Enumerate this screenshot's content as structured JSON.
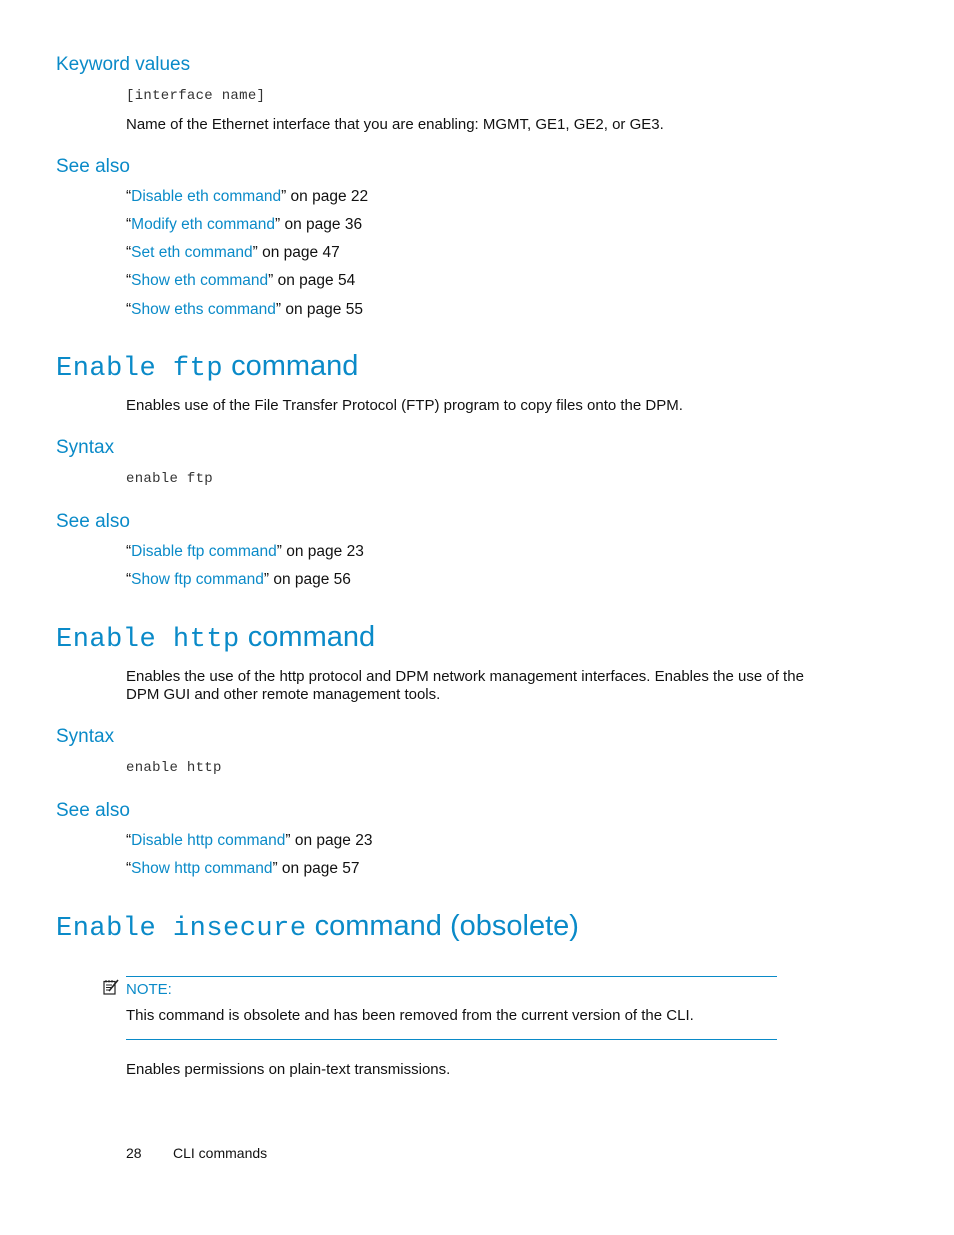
{
  "keyword_values": {
    "heading": "Keyword values",
    "param": "[interface name]",
    "description": "Name of the Ethernet interface that you are enabling: MGMT, GE1, GE2, or GE3."
  },
  "see_also_1": {
    "heading": "See also",
    "refs": [
      {
        "open": "“",
        "link": "Disable eth command",
        "rest": "” on page 22"
      },
      {
        "open": "“",
        "link": "Modify eth command",
        "rest": "” on page 36"
      },
      {
        "open": "“",
        "link": "Set eth command",
        "rest": "” on page 47"
      },
      {
        "open": "“",
        "link": "Show eth command",
        "rest": "” on page 54"
      },
      {
        "open": "“",
        "link": "Show eths command",
        "rest": "” on page 55"
      }
    ]
  },
  "ftp": {
    "title_code": "Enable ftp",
    "title_text": "command",
    "description": "Enables use of the File Transfer Protocol (FTP) program to copy files onto the DPM.",
    "syntax_heading": "Syntax",
    "syntax": "enable ftp",
    "see_also_heading": "See also",
    "refs": [
      {
        "open": "“",
        "link": "Disable ftp command",
        "rest": "” on page 23"
      },
      {
        "open": "“",
        "link": "Show ftp command",
        "rest": "” on page 56"
      }
    ]
  },
  "http": {
    "title_code": "Enable http",
    "title_text": "command",
    "description_line1": "Enables the use of the http protocol and DPM network management interfaces. Enables the use of the",
    "description_line2": "DPM GUI and other remote management tools.",
    "syntax_heading": "Syntax",
    "syntax": "enable http",
    "see_also_heading": "See also",
    "refs": [
      {
        "open": "“",
        "link": "Disable http command",
        "rest": "” on page 23"
      },
      {
        "open": "“",
        "link": "Show http command",
        "rest": "” on page 57"
      }
    ]
  },
  "insecure": {
    "title_code": "Enable insecure",
    "title_text": "command (obsolete)",
    "note_label": "NOTE:",
    "note_text": "This command is obsolete and has been removed from the current version of the CLI.",
    "description": "Enables permissions on plain-text transmissions."
  },
  "footer": {
    "page_number": "28",
    "section": "CLI commands"
  },
  "colors": {
    "accent": "#0a8ac8",
    "text": "#111111"
  }
}
